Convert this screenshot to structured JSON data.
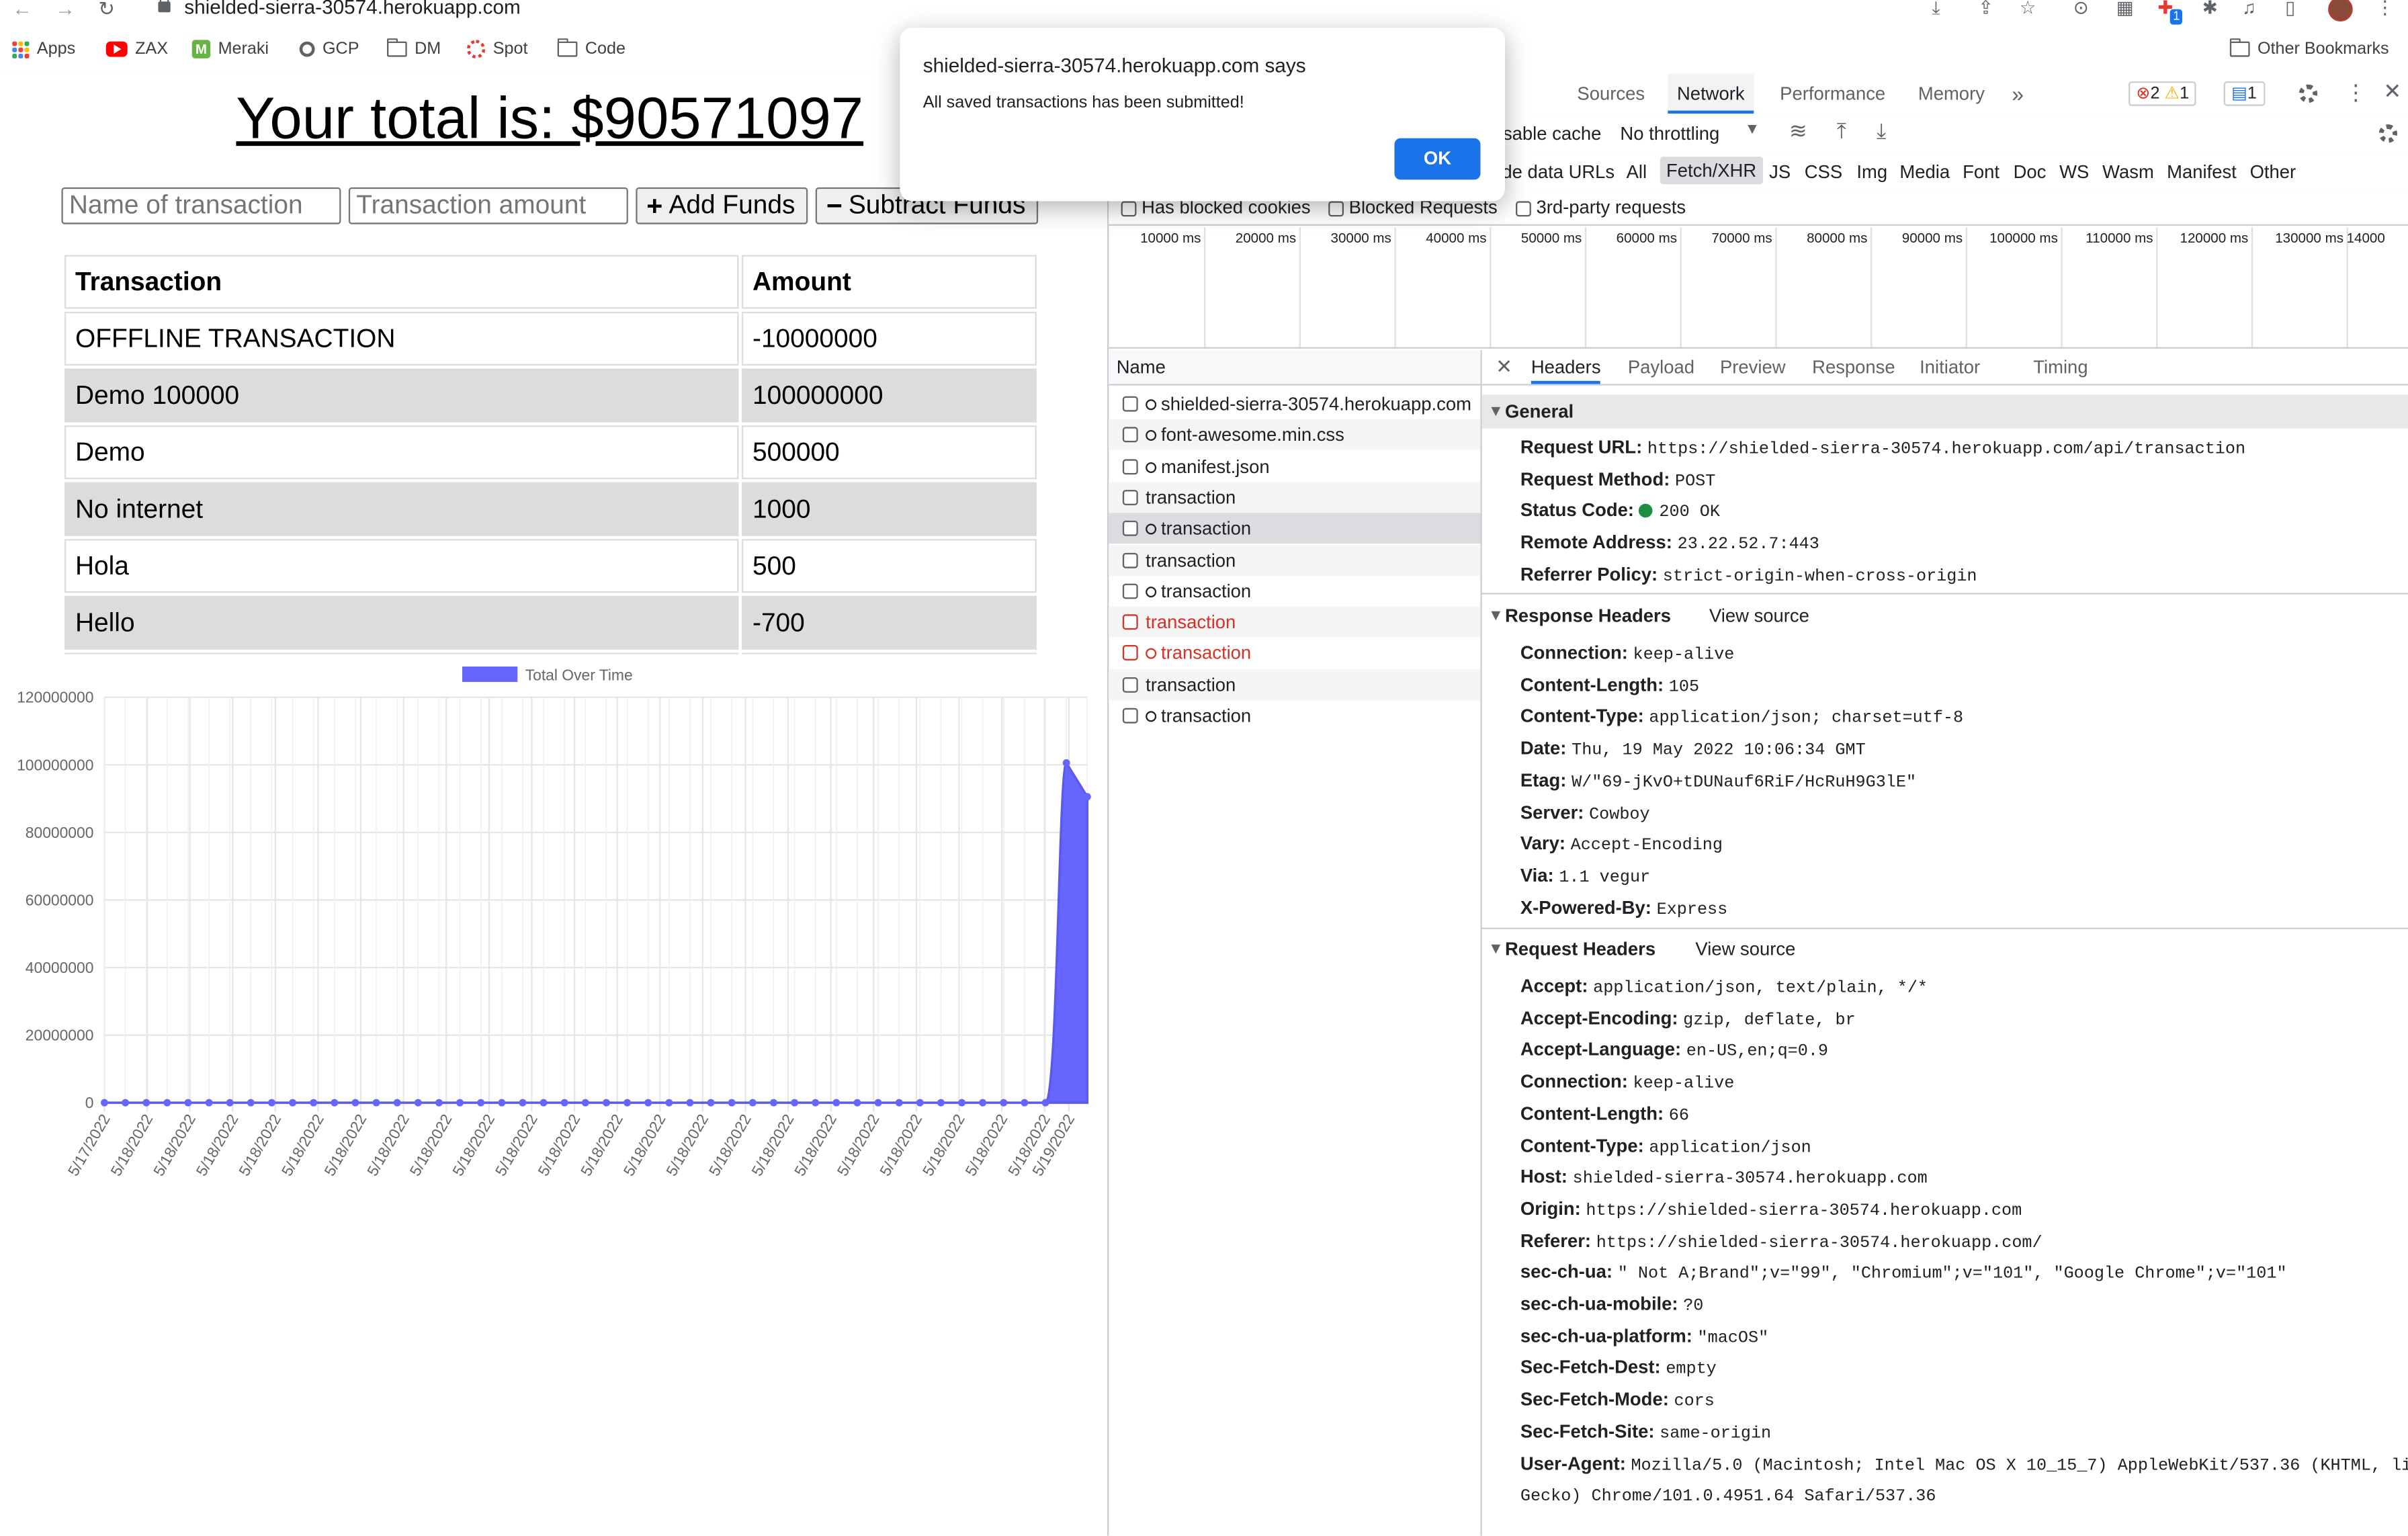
{
  "browser": {
    "url": "shielded-sierra-30574.herokuapp.com",
    "bookmarks": [
      "Apps",
      "ZAX",
      "Meraki",
      "GCP",
      "DM",
      "Spot",
      "Code"
    ],
    "other_bookmarks": "Other Bookmarks",
    "ext_badge": "1"
  },
  "app": {
    "total_text": "Your total is: $90571097",
    "name_placeholder": "Name of transaction",
    "amount_placeholder": "Transaction amount",
    "add_label": "Add Funds",
    "subtract_label": "Subtract Funds",
    "table_headers": [
      "Transaction",
      "Amount"
    ],
    "rows": [
      {
        "name": "OFFFLINE TRANSACTION",
        "amount": "-10000000"
      },
      {
        "name": "Demo 100000",
        "amount": "100000000"
      },
      {
        "name": "Demo",
        "amount": "500000"
      },
      {
        "name": "No internet",
        "amount": "1000"
      },
      {
        "name": "Hola",
        "amount": "500"
      },
      {
        "name": "Hello",
        "amount": "-700"
      }
    ]
  },
  "chart_data": {
    "type": "area",
    "legend": "Total Over Time",
    "color": "#6666ff",
    "ylim": [
      0,
      120000000
    ],
    "yticks": [
      "0",
      "20000000",
      "40000000",
      "60000000",
      "80000000",
      "100000000",
      "120000000"
    ],
    "x_tick_labels": [
      "5/17/2022",
      "5/18/2022",
      "5/18/2022",
      "5/18/2022",
      "5/18/2022",
      "5/18/2022",
      "5/18/2022",
      "5/18/2022",
      "5/18/2022",
      "5/18/2022",
      "5/18/2022",
      "5/18/2022",
      "5/18/2022",
      "5/18/2022",
      "5/18/2022",
      "5/18/2022",
      "5/18/2022",
      "5/18/2022",
      "5/18/2022",
      "5/18/2022",
      "5/18/2022",
      "5/18/2022",
      "5/18/2022",
      "5/19/2022"
    ],
    "values": [
      0,
      0,
      0,
      0,
      0,
      0,
      0,
      0,
      0,
      0,
      0,
      0,
      0,
      0,
      0,
      0,
      0,
      0,
      0,
      0,
      0,
      0,
      0,
      0,
      0,
      0,
      0,
      0,
      0,
      0,
      0,
      0,
      0,
      0,
      0,
      0,
      0,
      0,
      0,
      0,
      0,
      0,
      0,
      0,
      0,
      0,
      100571097,
      90571097
    ],
    "grid": true,
    "legend_position": "top"
  },
  "devtools": {
    "main_tabs": [
      "Sources",
      "Network",
      "Performance",
      "Memory"
    ],
    "active_tab": "Network",
    "more": "»",
    "errors": "2",
    "warnings": "1",
    "messages": "1",
    "toolbar": {
      "disable_cache": "isable cache",
      "throttle": "No throttling"
    },
    "filters": [
      "de data URLs",
      "All",
      "Fetch/XHR",
      "JS",
      "CSS",
      "Img",
      "Media",
      "Font",
      "Doc",
      "WS",
      "Wasm",
      "Manifest",
      "Other"
    ],
    "checkboxes": [
      "Has blocked cookies",
      "Blocked Requests",
      "3rd-party requests"
    ],
    "ruler": [
      "10000 ms",
      "20000 ms",
      "30000 ms",
      "40000 ms",
      "50000 ms",
      "60000 ms",
      "70000 ms",
      "80000 ms",
      "90000 ms",
      "100000 ms",
      "110000 ms",
      "120000 ms",
      "130000 ms",
      "14000"
    ],
    "name_header": "Name",
    "requests": [
      {
        "name": "shielded-sierra-30574.herokuapp.com",
        "gear": true,
        "error": false
      },
      {
        "name": "font-awesome.min.css",
        "gear": true,
        "error": false
      },
      {
        "name": "manifest.json",
        "gear": true,
        "error": false
      },
      {
        "name": "transaction",
        "gear": false,
        "error": false
      },
      {
        "name": "transaction",
        "gear": true,
        "error": false
      },
      {
        "name": "transaction",
        "gear": false,
        "error": false
      },
      {
        "name": "transaction",
        "gear": true,
        "error": false
      },
      {
        "name": "transaction",
        "gear": false,
        "error": true
      },
      {
        "name": "transaction",
        "gear": true,
        "error": true
      },
      {
        "name": "transaction",
        "gear": false,
        "error": false
      },
      {
        "name": "transaction",
        "gear": true,
        "error": false
      }
    ],
    "detail_tabs": [
      "Headers",
      "Payload",
      "Preview",
      "Response",
      "Initiator",
      "Timing"
    ],
    "general_title": "General",
    "general": [
      {
        "k": "Request URL:",
        "v": "https://shielded-sierra-30574.herokuapp.com/api/transaction"
      },
      {
        "k": "Request Method:",
        "v": "POST"
      },
      {
        "k": "Status Code:",
        "v": "200 OK"
      },
      {
        "k": "Remote Address:",
        "v": "23.22.52.7:443"
      },
      {
        "k": "Referrer Policy:",
        "v": "strict-origin-when-cross-origin"
      }
    ],
    "response_title": "Response Headers",
    "view_source": "View source",
    "response": [
      {
        "k": "Connection:",
        "v": "keep-alive"
      },
      {
        "k": "Content-Length:",
        "v": "105"
      },
      {
        "k": "Content-Type:",
        "v": "application/json; charset=utf-8"
      },
      {
        "k": "Date:",
        "v": "Thu, 19 May 2022 10:06:34 GMT"
      },
      {
        "k": "Etag:",
        "v": "W/\"69-jKvO+tDUNauf6RiF/HcRuH9G3lE\""
      },
      {
        "k": "Server:",
        "v": "Cowboy"
      },
      {
        "k": "Vary:",
        "v": "Accept-Encoding"
      },
      {
        "k": "Via:",
        "v": "1.1 vegur"
      },
      {
        "k": "X-Powered-By:",
        "v": "Express"
      }
    ],
    "request_title": "Request Headers",
    "request": [
      {
        "k": "Accept:",
        "v": "application/json, text/plain, */*"
      },
      {
        "k": "Accept-Encoding:",
        "v": "gzip, deflate, br"
      },
      {
        "k": "Accept-Language:",
        "v": "en-US,en;q=0.9"
      },
      {
        "k": "Connection:",
        "v": "keep-alive"
      },
      {
        "k": "Content-Length:",
        "v": "66"
      },
      {
        "k": "Content-Type:",
        "v": "application/json"
      },
      {
        "k": "Host:",
        "v": "shielded-sierra-30574.herokuapp.com"
      },
      {
        "k": "Origin:",
        "v": "https://shielded-sierra-30574.herokuapp.com"
      },
      {
        "k": "Referer:",
        "v": "https://shielded-sierra-30574.herokuapp.com/"
      },
      {
        "k": "sec-ch-ua:",
        "v": "\" Not A;Brand\";v=\"99\", \"Chromium\";v=\"101\", \"Google Chrome\";v=\"101\""
      },
      {
        "k": "sec-ch-ua-mobile:",
        "v": "?0"
      },
      {
        "k": "sec-ch-ua-platform:",
        "v": "\"macOS\""
      },
      {
        "k": "Sec-Fetch-Dest:",
        "v": "empty"
      },
      {
        "k": "Sec-Fetch-Mode:",
        "v": "cors"
      },
      {
        "k": "Sec-Fetch-Site:",
        "v": "same-origin"
      },
      {
        "k": "User-Agent:",
        "v": "Mozilla/5.0 (Macintosh; Intel Mac OS X 10_15_7) AppleWebKit/537.36 (KHTML, like"
      }
    ],
    "user_agent_cont": "Gecko) Chrome/101.0.4951.64 Safari/537.36"
  },
  "alert": {
    "title": "shielded-sierra-30574.herokuapp.com says",
    "message": "All saved transactions has been submitted!",
    "ok": "OK"
  }
}
